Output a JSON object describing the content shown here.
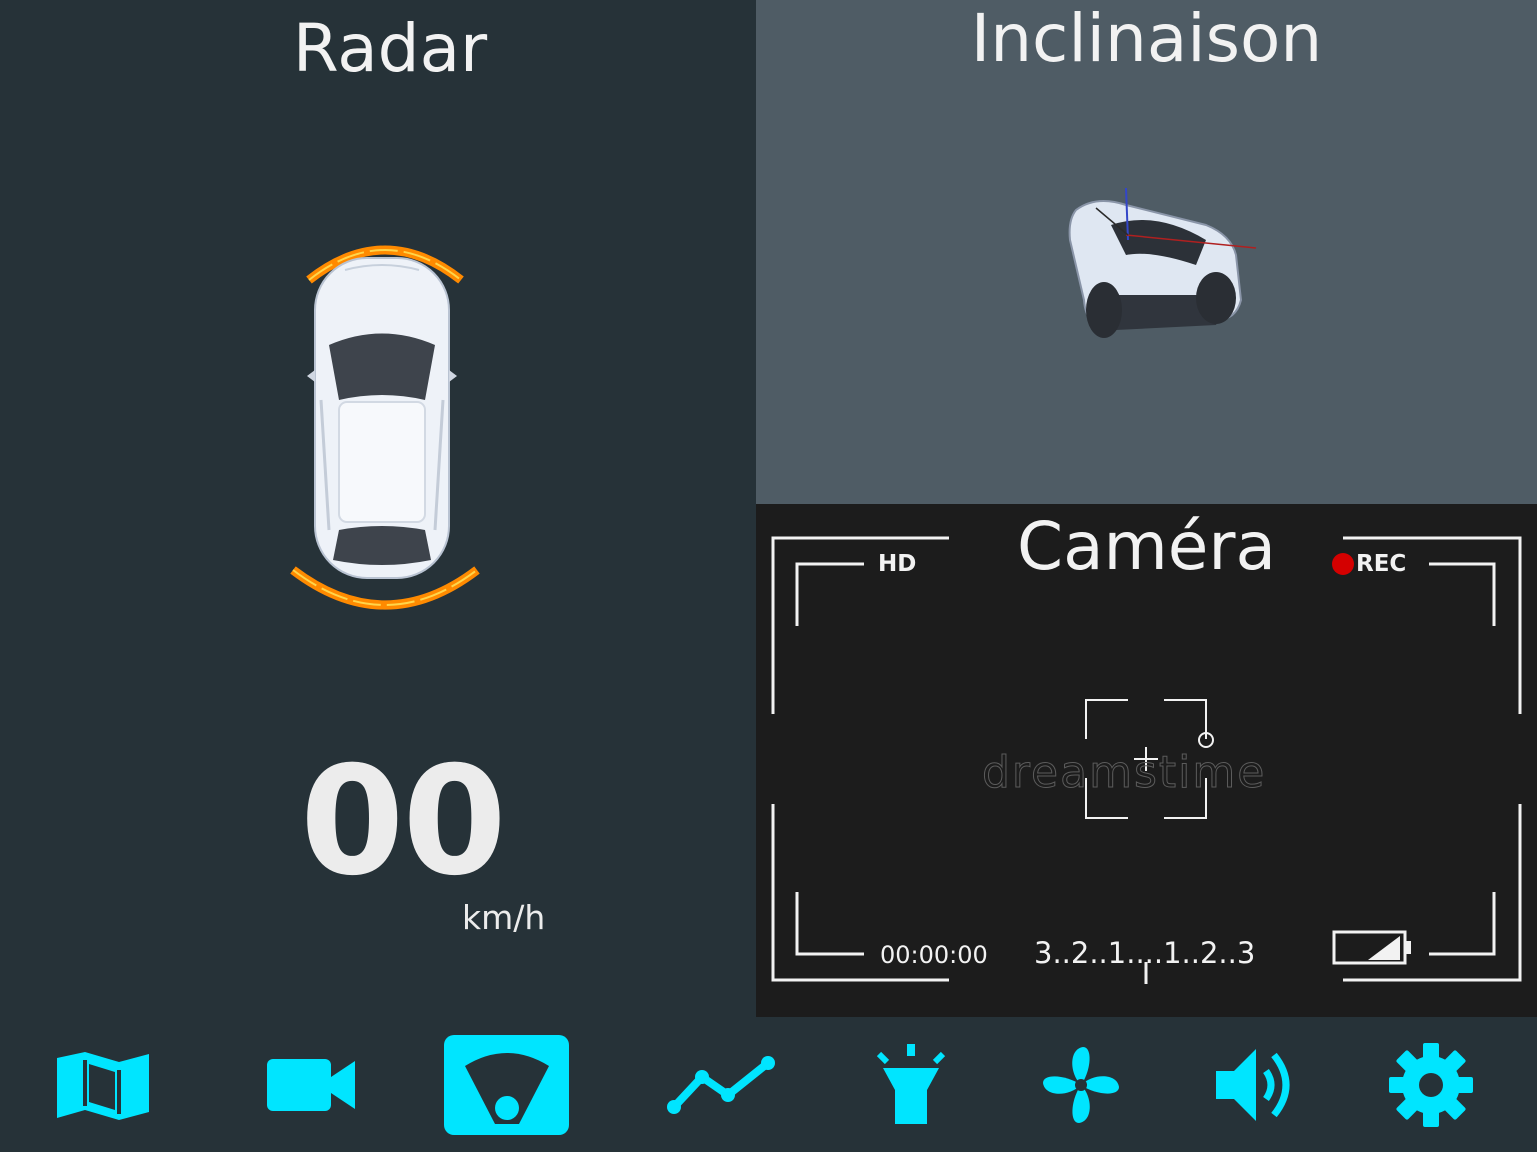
{
  "panels": {
    "radar": {
      "title": "Radar",
      "speed_value": "00",
      "speed_unit": "km/h"
    },
    "tilt": {
      "title": "Inclinaison"
    },
    "camera": {
      "title": "Caméra",
      "quality": "HD",
      "record_label": "REC",
      "timecode": "00:00:00",
      "exposure_scale": "3..2..1..​..1..2..3",
      "watermark": "dreamstime"
    }
  },
  "nav": {
    "items": [
      {
        "name": "map",
        "icon": "map-icon",
        "active": false
      },
      {
        "name": "camera",
        "icon": "video-camera-icon",
        "active": false
      },
      {
        "name": "radar",
        "icon": "radar-gauge-icon",
        "active": true
      },
      {
        "name": "chart",
        "icon": "line-chart-icon",
        "active": false
      },
      {
        "name": "light",
        "icon": "flashlight-icon",
        "active": false
      },
      {
        "name": "fan",
        "icon": "fan-icon",
        "active": false
      },
      {
        "name": "sound",
        "icon": "volume-icon",
        "active": false
      },
      {
        "name": "settings",
        "icon": "gear-icon",
        "active": false
      }
    ]
  },
  "colors": {
    "accent": "#00e5ff",
    "radar_bg": "#263238",
    "tilt_bg": "#4f5c65",
    "camera_bg": "#1c1c1c",
    "sensor_arc": "#ff8a00",
    "rec_dot": "#d40000"
  }
}
